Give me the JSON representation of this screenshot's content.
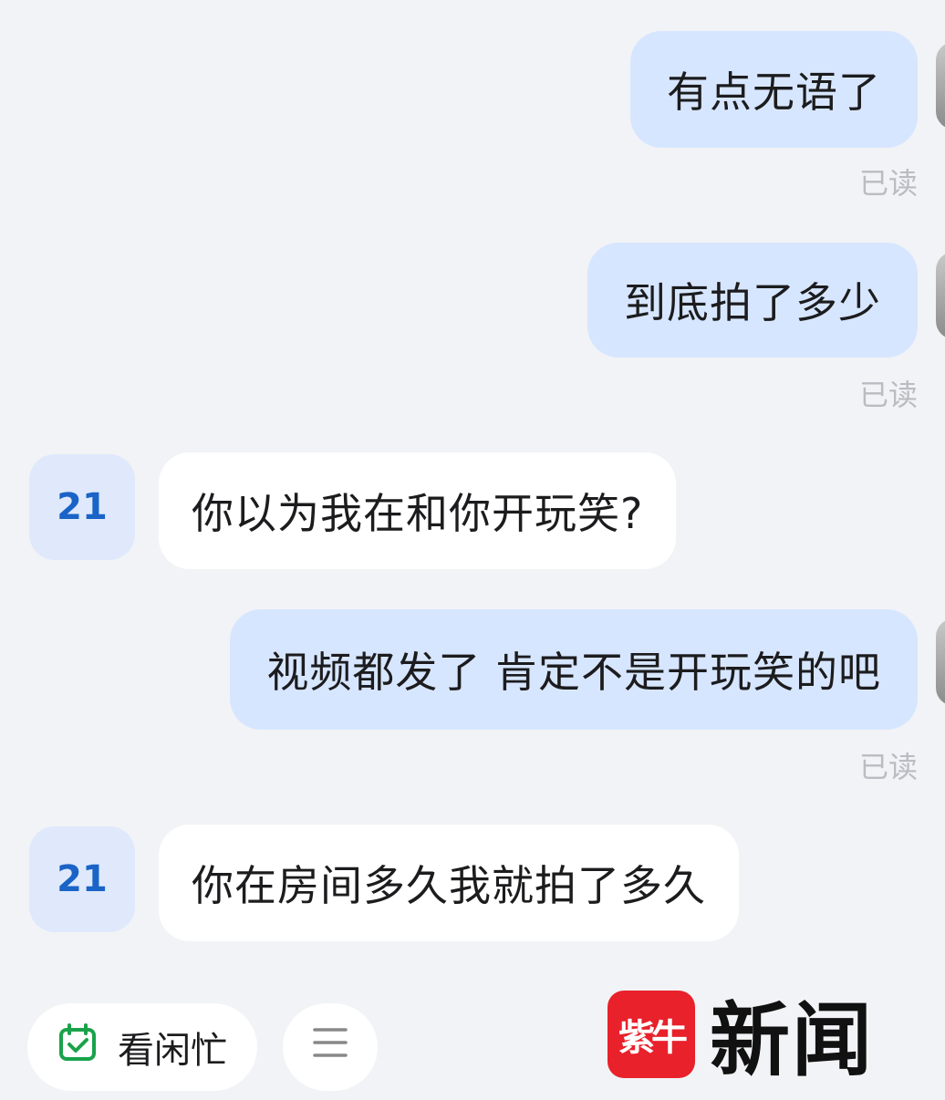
{
  "messages": [
    {
      "direction": "sent",
      "text": "有点无语了",
      "status": "已读"
    },
    {
      "direction": "sent",
      "text": "到底拍了多少",
      "status": "已读"
    },
    {
      "direction": "received",
      "avatar": "21",
      "text": "你以为我在和你开玩笑?"
    },
    {
      "direction": "sent",
      "text": "视频都发了 肯定不是开玩笑的吧",
      "status": "已读"
    },
    {
      "direction": "received",
      "avatar": "21",
      "text": "你在房间多久我就拍了多久"
    }
  ],
  "bottom_bar": {
    "status_label": "看闲忙",
    "status_icon": "calendar-check-icon",
    "menu_icon": "menu-icon"
  },
  "watermark": {
    "logo_text": "紫牛",
    "text": "新闻"
  },
  "colors": {
    "background": "#f2f3f6",
    "sent_bubble": "#d7e6ff",
    "received_bubble": "#ffffff",
    "avatar_text": "#1a63c7",
    "status_icon": "#19a24a",
    "watermark_logo": "#e8212b"
  }
}
